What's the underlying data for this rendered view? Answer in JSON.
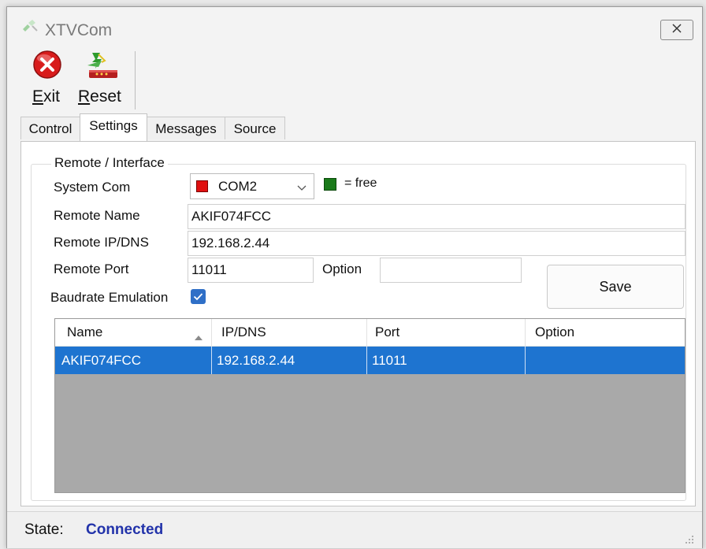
{
  "window": {
    "title": "XTVCom"
  },
  "toolbar": {
    "exit_label": "Exit",
    "reset_label": "Reset"
  },
  "tabs": [
    {
      "label": "Control",
      "active": false
    },
    {
      "label": "Settings",
      "active": true
    },
    {
      "label": "Messages",
      "active": false
    },
    {
      "label": "Source",
      "active": false
    }
  ],
  "settings": {
    "group_title": "Remote / Interface",
    "system_com": {
      "label": "System Com",
      "value": "COM2",
      "status_color": "#e01010"
    },
    "free_legend": {
      "label": "= free",
      "color": "#1a7a1a"
    },
    "remote_name": {
      "label": "Remote Name",
      "value": "AKIF074FCC"
    },
    "remote_ip": {
      "label": "Remote IP/DNS",
      "value": "192.168.2.44"
    },
    "remote_port": {
      "label": "Remote Port",
      "value": "11011"
    },
    "option": {
      "label": "Option",
      "value": ""
    },
    "baudrate": {
      "label": "Baudrate Emulation",
      "checked": true
    },
    "save_label": "Save"
  },
  "list": {
    "columns": [
      "Name",
      "IP/DNS",
      "Port",
      "Option"
    ],
    "rows": [
      {
        "name": "AKIF074FCC",
        "ip": "192.168.2.44",
        "port": "11011",
        "option": "",
        "selected": true
      }
    ],
    "selection_color": "#1e74d0"
  },
  "status": {
    "label": "State:",
    "value": "Connected",
    "value_color": "#2233aa"
  },
  "icons": {
    "app": "plug-icon",
    "exit": "exit-icon",
    "reset": "reset-icon"
  }
}
